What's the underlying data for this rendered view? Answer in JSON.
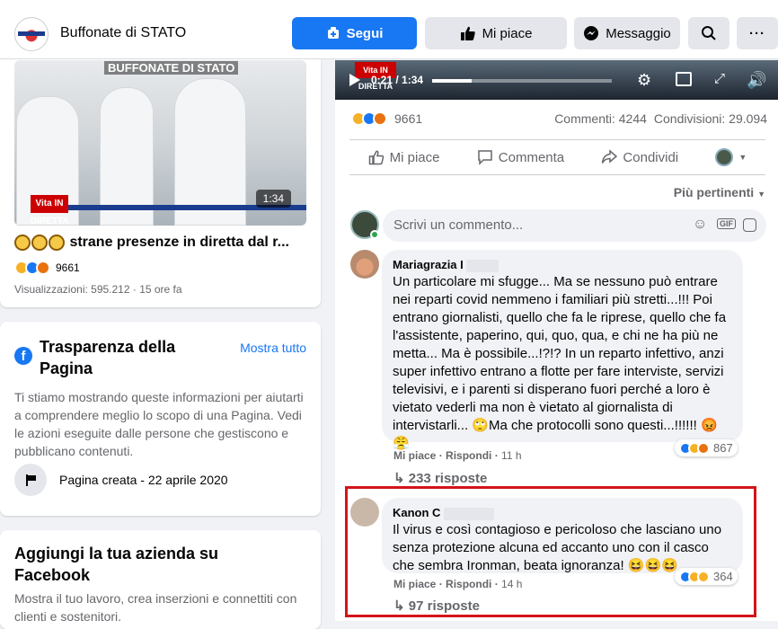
{
  "header": {
    "page_name": "Buffonate di STATO",
    "segui_label": "Segui",
    "mipiace_label": "Mi piace",
    "messaggio_label": "Messaggio"
  },
  "left": {
    "video_overlay_title": "BUFFONATE DI STATO",
    "video_duration": "1:34",
    "video_logo": "Vita IN DIRETTA",
    "post_title": "strane presenze in diretta dal r...",
    "reactions_count": "9661",
    "views_line": "Visualizzazioni: 595.212 · 15 ore fa"
  },
  "transparency": {
    "title": "Trasparenza della Pagina",
    "see_all": "Mostra tutto",
    "description": "Ti stiamo mostrando queste informazioni per aiutarti a comprendere meglio lo scopo di una Pagina. Vedi le azioni eseguite dalle persone che gestiscono e pubblicano contenuti.",
    "created_label": "Pagina creata - 22 aprile 2020"
  },
  "business": {
    "title": "Aggiungi la tua azienda su Facebook",
    "description": "Mostra il tuo lavoro, crea inserzioni e connettiti con clienti e sostenitori."
  },
  "player": {
    "time": "0:21 / 1:34",
    "logo": "Vita IN DIRETTA",
    "progress": 0.22
  },
  "stats": {
    "reactions": "9661",
    "comments": "Commenti: 4244",
    "shares": "Condivisioni: 29.094"
  },
  "actions": {
    "like": "Mi piace",
    "comment": "Commenta",
    "share": "Condividi"
  },
  "sort_label": "Più pertinenti",
  "write_placeholder": "Scrivi un commento...",
  "comments": [
    {
      "name": "Mariagrazia I",
      "text": "Un particolare mi sfugge... Ma se nessuno può entrare nei reparti covid nemmeno i familiari più stretti...!!! Poi entrano giornalisti, quello che fa le riprese, quello che fa l'assistente, paperino, qui, quo, qua, e chi ne ha più ne metta... Ma è possibile...!?!? In un reparto infettivo, anzi super infettivo entrano a flotte per fare interviste, servizi televisivi, e i parenti si disperano fuori perché a loro è vietato vederli ma non è vietato al giornalista di intervistarli... 🙄Ma che protocolli sono questi...!!!!!! 😡 😤",
      "like": "Mi piace",
      "reply": "Rispondi",
      "time": "11 h",
      "reactions": "867",
      "replies": "233 risposte"
    },
    {
      "name": "Kanon C",
      "text": "Il virus e così contagioso e pericoloso che lasciano uno senza protezione alcuna ed accanto uno con il casco che sembra Ironman, beata ignoranza! 😆😆😆",
      "like": "Mi piace",
      "reply": "Rispondi",
      "time": "14 h",
      "reactions": "364",
      "replies": "97 risposte"
    }
  ],
  "colors": {
    "brand_blue": "#1877f2",
    "highlight_red": "#d3141b"
  }
}
